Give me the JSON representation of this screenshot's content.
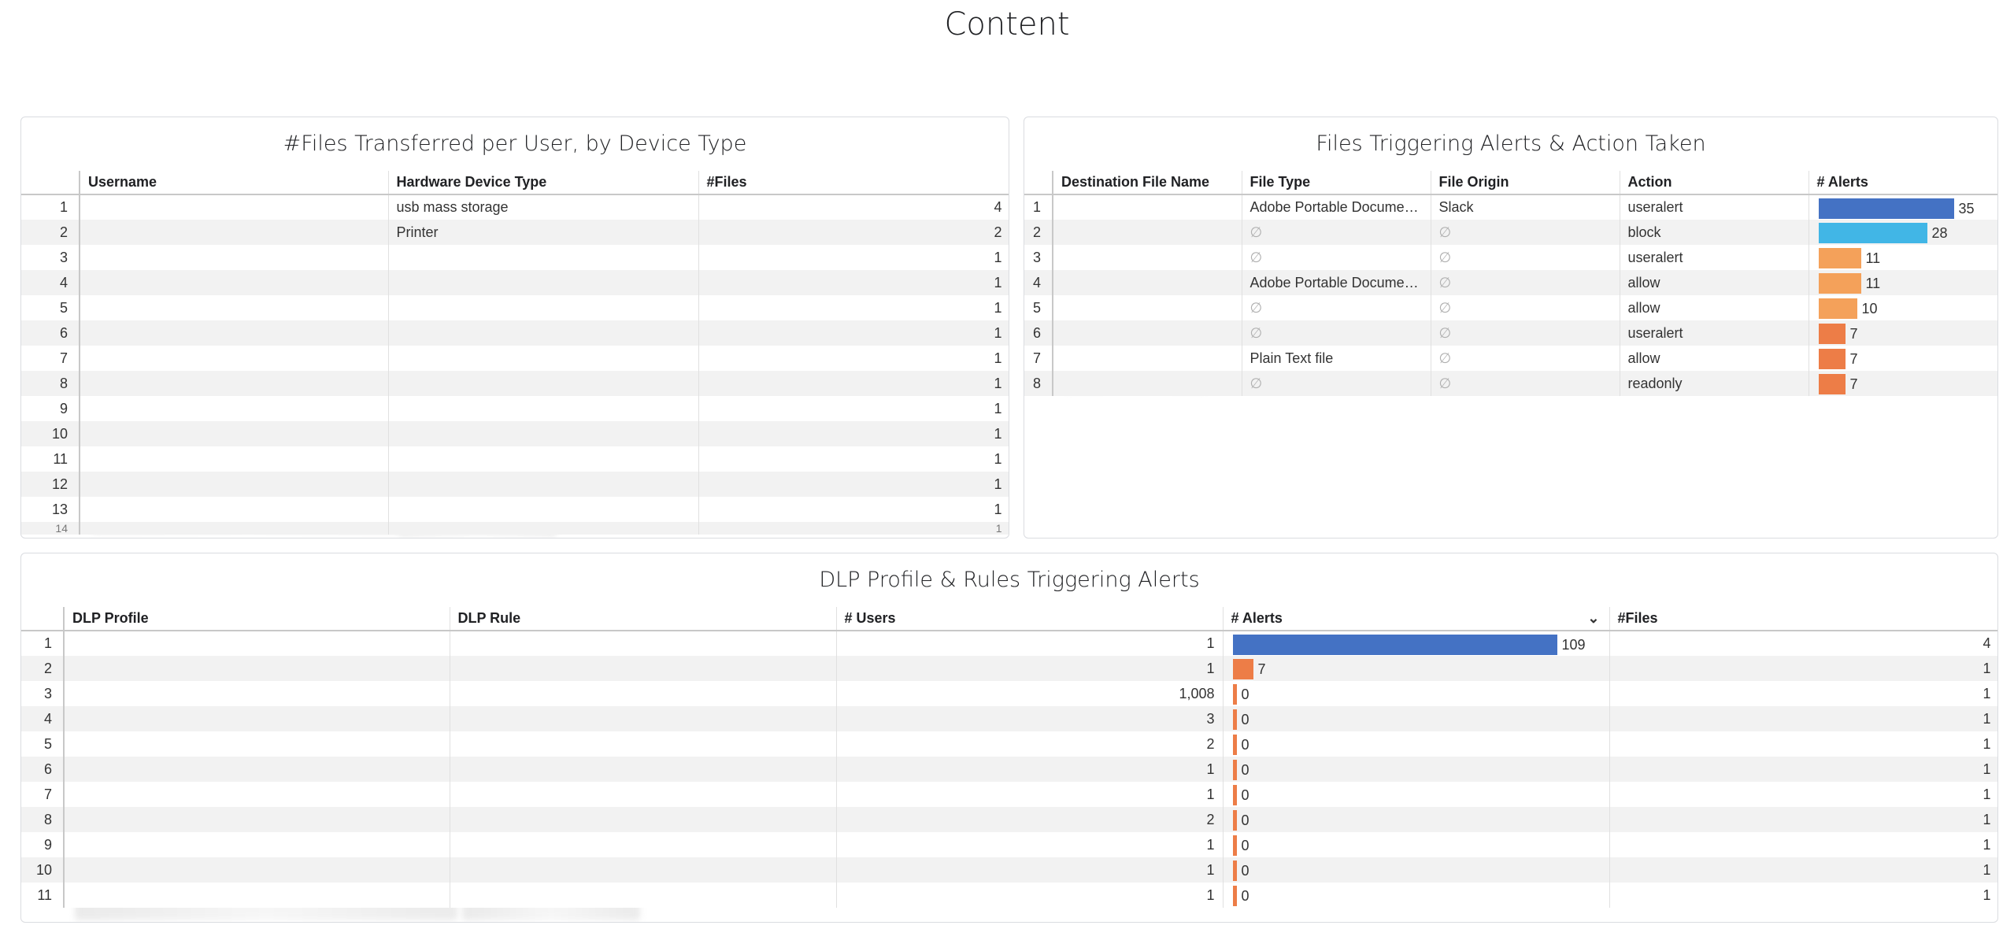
{
  "page": {
    "title": "Content"
  },
  "panel1": {
    "title": "#Files Transferred per User, by Device Type",
    "columns": [
      "Username",
      "Hardware Device Type",
      "#Files"
    ],
    "rows": [
      {
        "idx": "1",
        "device": "usb mass storage",
        "files": "4"
      },
      {
        "idx": "2",
        "device": "Printer",
        "files": "2"
      },
      {
        "idx": "3",
        "device": "",
        "files": "1"
      },
      {
        "idx": "4",
        "device": "",
        "files": "1"
      },
      {
        "idx": "5",
        "device": "",
        "files": "1"
      },
      {
        "idx": "6",
        "device": "",
        "files": "1"
      },
      {
        "idx": "7",
        "device": "",
        "files": "1"
      },
      {
        "idx": "8",
        "device": "",
        "files": "1"
      },
      {
        "idx": "9",
        "device": "",
        "files": "1"
      },
      {
        "idx": "10",
        "device": "",
        "files": "1"
      },
      {
        "idx": "11",
        "device": "",
        "files": "1"
      },
      {
        "idx": "12",
        "device": "",
        "files": "1"
      },
      {
        "idx": "13",
        "device": "",
        "files": "1"
      }
    ],
    "partial_row": {
      "idx": "14",
      "files": "1"
    }
  },
  "panel2": {
    "title": "Files Triggering Alerts & Action Taken",
    "columns": [
      "Destination File Name",
      "File Type",
      "File Origin",
      "Action",
      "# Alerts"
    ],
    "null_symbol": "∅",
    "alerts_max": 35,
    "rows": [
      {
        "idx": "1",
        "type": "Adobe Portable Docume…",
        "origin": "Slack",
        "action": "useralert",
        "alerts": 35,
        "alerts_label": "35",
        "color": "#4472c4"
      },
      {
        "idx": "2",
        "type": "∅",
        "origin": "∅",
        "action": "block",
        "alerts": 28,
        "alerts_label": "28",
        "color": "#41b6e6"
      },
      {
        "idx": "3",
        "type": "∅",
        "origin": "∅",
        "action": "useralert",
        "alerts": 11,
        "alerts_label": "11",
        "color": "#f4a15a"
      },
      {
        "idx": "4",
        "type": "Adobe Portable Docume…",
        "origin": "∅",
        "action": "allow",
        "alerts": 11,
        "alerts_label": "11",
        "color": "#f4a15a"
      },
      {
        "idx": "5",
        "type": "∅",
        "origin": "∅",
        "action": "allow",
        "alerts": 10,
        "alerts_label": "10",
        "color": "#f4a15a"
      },
      {
        "idx": "6",
        "type": "∅",
        "origin": "∅",
        "action": "useralert",
        "alerts": 7,
        "alerts_label": "7",
        "color": "#ed7d47"
      },
      {
        "idx": "7",
        "type": "Plain Text file",
        "origin": "∅",
        "action": "allow",
        "alerts": 7,
        "alerts_label": "7",
        "color": "#ed7d47"
      },
      {
        "idx": "8",
        "type": "∅",
        "origin": "∅",
        "action": "readonly",
        "alerts": 7,
        "alerts_label": "7",
        "color": "#ed7d47"
      }
    ]
  },
  "panel3": {
    "title": "DLP Profile & Rules Triggering Alerts",
    "columns": [
      "DLP Profile",
      "DLP Rule",
      "# Users",
      "# Alerts",
      "#Files"
    ],
    "sort_icon": "chevron-down-icon",
    "alerts_max": 109,
    "rows": [
      {
        "idx": "1",
        "users": "1",
        "alerts": 109,
        "alerts_label": "109",
        "files": "4",
        "color": "#4472c4"
      },
      {
        "idx": "2",
        "users": "1",
        "alerts": 7,
        "alerts_label": "7",
        "files": "1",
        "color": "#ed7d47"
      },
      {
        "idx": "3",
        "users": "1,008",
        "alerts": 0,
        "alerts_label": "0",
        "files": "1",
        "color": "#ed7d47"
      },
      {
        "idx": "4",
        "users": "3",
        "alerts": 0,
        "alerts_label": "0",
        "files": "1",
        "color": "#ed7d47"
      },
      {
        "idx": "5",
        "users": "2",
        "alerts": 0,
        "alerts_label": "0",
        "files": "1",
        "color": "#ed7d47"
      },
      {
        "idx": "6",
        "users": "1",
        "alerts": 0,
        "alerts_label": "0",
        "files": "1",
        "color": "#ed7d47"
      },
      {
        "idx": "7",
        "users": "1",
        "alerts": 0,
        "alerts_label": "0",
        "files": "1",
        "color": "#ed7d47"
      },
      {
        "idx": "8",
        "users": "2",
        "alerts": 0,
        "alerts_label": "0",
        "files": "1",
        "color": "#ed7d47"
      },
      {
        "idx": "9",
        "users": "1",
        "alerts": 0,
        "alerts_label": "0",
        "files": "1",
        "color": "#ed7d47"
      },
      {
        "idx": "10",
        "users": "1",
        "alerts": 0,
        "alerts_label": "0",
        "files": "1",
        "color": "#ed7d47"
      },
      {
        "idx": "11",
        "users": "1",
        "alerts": 0,
        "alerts_label": "0",
        "files": "1",
        "color": "#ed7d47"
      }
    ]
  }
}
